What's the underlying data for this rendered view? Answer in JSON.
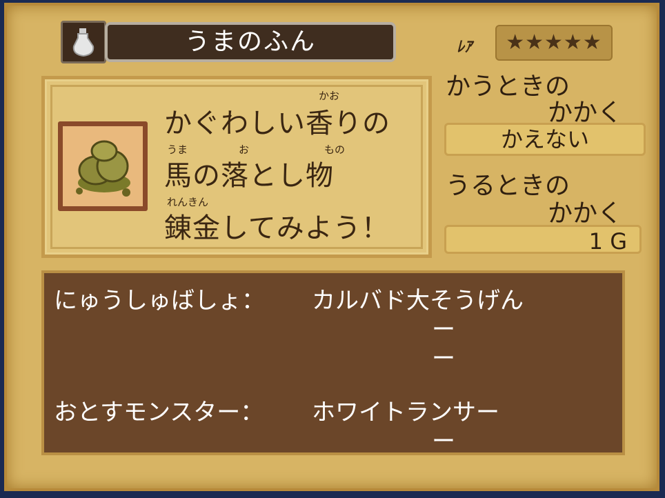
{
  "item": {
    "name": "うまのふん",
    "icon": "bottle-icon",
    "thumbnail": "dung-icon"
  },
  "rank": {
    "label": "ﾚｱ",
    "stars": "★★★★★"
  },
  "description": {
    "line1": "かぐわしい香りの",
    "line2": "馬の落とし物",
    "line3": "錬金してみよう！",
    "ruby_kao": "かお",
    "ruby_uma": "うま",
    "ruby_o": "お",
    "ruby_mono": "もの",
    "ruby_renkin": "れんきん"
  },
  "buy": {
    "label_line1": "かうときの",
    "label_line2": "かかく",
    "value": "かえない"
  },
  "sell": {
    "label_line1": "うるときの",
    "label_line2": "かかく",
    "value": "1 G"
  },
  "info": {
    "obtain_label": "にゅうしゅばしょ：",
    "obtain_values": [
      "カルバド大そうげん",
      "ー",
      "ー"
    ],
    "drop_label": "おとすモンスター：",
    "drop_values": [
      "ホワイトランサー",
      "ー"
    ]
  }
}
